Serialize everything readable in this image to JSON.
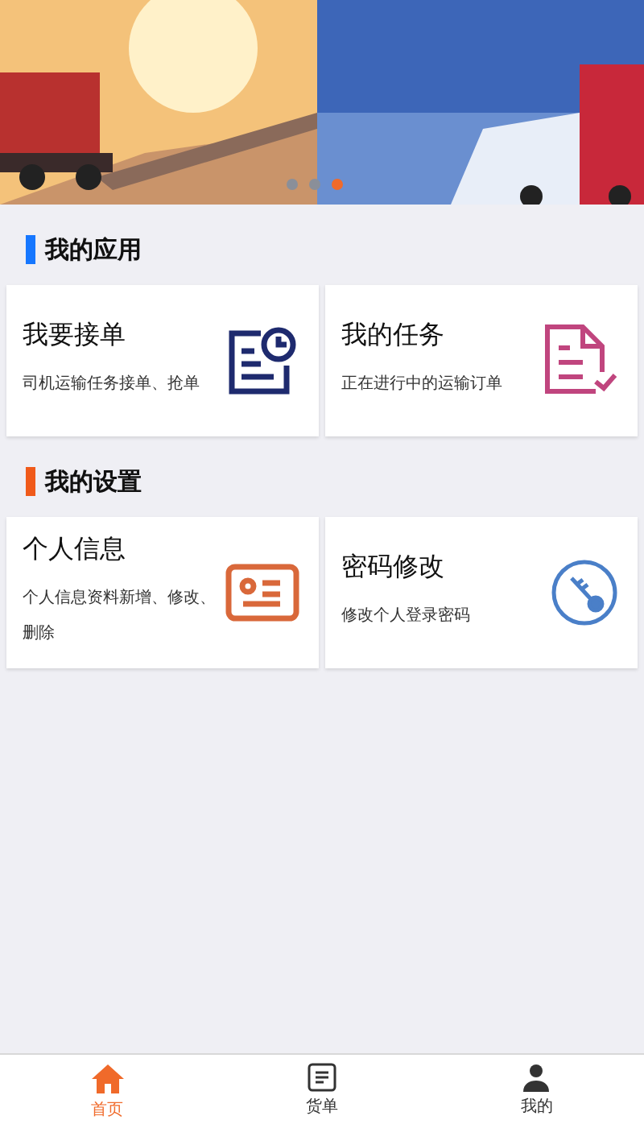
{
  "banner": {
    "dots": [
      {
        "selected": false
      },
      {
        "selected": false
      },
      {
        "selected": true
      }
    ]
  },
  "sections": [
    {
      "title": "我的应用",
      "color": "#1677ff",
      "cards": [
        {
          "title": "我要接单",
          "description": "司机运输任务接单、抢单",
          "kind": "doc-clock",
          "color": "#1e2a6e"
        },
        {
          "title": "我的任务",
          "description": "正在进行中的运输订单",
          "kind": "doc-check",
          "color": "#c0457e"
        }
      ]
    },
    {
      "title": "我的设置",
      "color": "#f05a1a",
      "cards": [
        {
          "title": "个人信息",
          "description": "个人信息资料新增、修改、删除",
          "kind": "id-card",
          "color": "#d9683a"
        },
        {
          "title": "密码修改",
          "description": "修改个人登录密码",
          "kind": "key",
          "color": "#4a7fc8"
        }
      ]
    }
  ],
  "tabs": [
    {
      "label": "首页",
      "kind": "home",
      "selected": true
    },
    {
      "label": "货单",
      "kind": "list",
      "selected": false
    },
    {
      "label": "我的",
      "kind": "person",
      "selected": false
    }
  ]
}
